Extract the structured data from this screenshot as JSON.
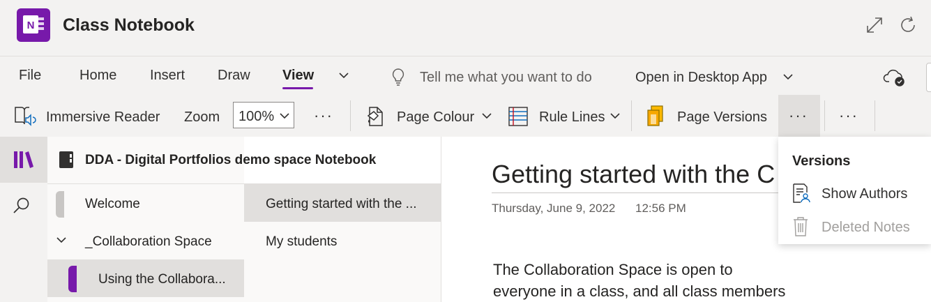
{
  "app": {
    "title": "Class Notebook",
    "logo_letter": "N",
    "brand_color": "#7719aa"
  },
  "ribbon": {
    "tabs": [
      "File",
      "Home",
      "Insert",
      "Draw",
      "View"
    ],
    "active_tab": "View",
    "search_hint": "Tell me what you want to do",
    "open_desktop": "Open in Desktop App",
    "commands": {
      "immersive_reader": "Immersive Reader",
      "zoom_label": "Zoom",
      "zoom_value": "100%",
      "page_colour": "Page Colour",
      "rule_lines": "Rule Lines",
      "page_versions": "Page Versions",
      "more": "···"
    }
  },
  "notebook": {
    "name": "DDA - Digital Portfolios demo space Notebook",
    "sections": [
      {
        "label": "Welcome"
      },
      {
        "label": "_Collaboration Space",
        "is_group": true
      },
      {
        "label": "Using the Collabora...",
        "selected": true
      }
    ],
    "pages": [
      {
        "label": "Getting started with the ...",
        "selected": true
      },
      {
        "label": "My students"
      }
    ]
  },
  "page": {
    "title": "Getting started with the C",
    "date": "Thursday, June 9, 2022",
    "time": "12:56 PM",
    "body_lines": [
      "The Collaboration Space is open to",
      "everyone in a class, and all class members"
    ]
  },
  "versions_menu": {
    "header": "Versions",
    "items": [
      {
        "label": "Show Authors",
        "enabled": true
      },
      {
        "label": "Deleted Notes",
        "enabled": false
      }
    ]
  }
}
